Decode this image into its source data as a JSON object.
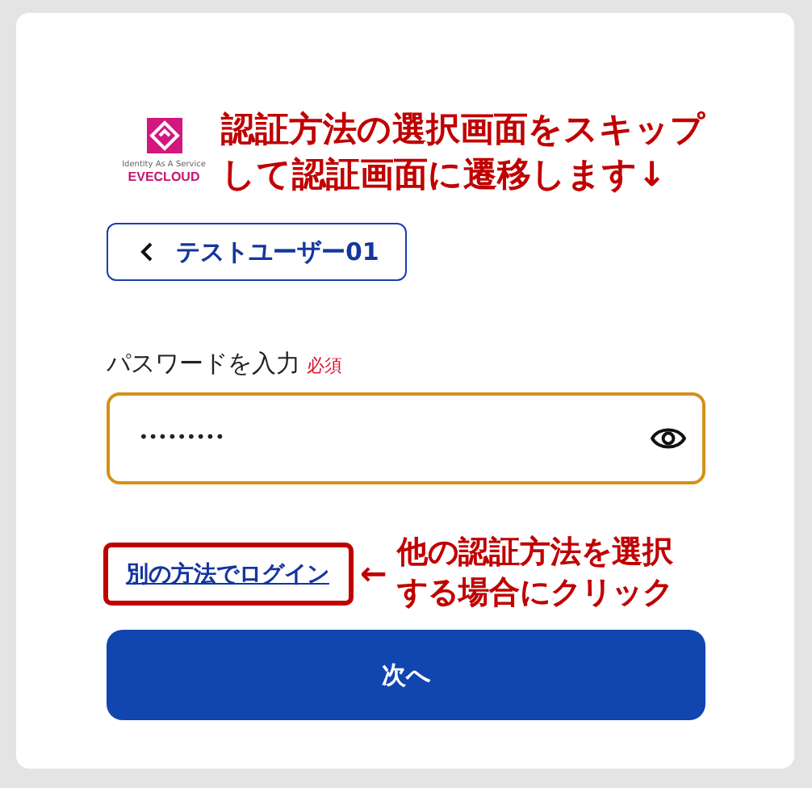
{
  "logo": {
    "tagline": "Identity As A Service",
    "brand": "EVECLOUD"
  },
  "top_annotation": {
    "lines": [
      "認証方法の選択画面をスキップ",
      "して認証画面に遷移します↓"
    ]
  },
  "back_button": {
    "label": "テストユーザー01"
  },
  "password": {
    "label": "パスワードを入力",
    "required_badge": "必須",
    "value": "•••••••••"
  },
  "alt_login": {
    "link": "別の方法でログイン",
    "arrow": "←",
    "annotation_lines": [
      "他の認証方法を選択",
      "する場合にクリック"
    ]
  },
  "next_button": {
    "label": "次へ"
  }
}
